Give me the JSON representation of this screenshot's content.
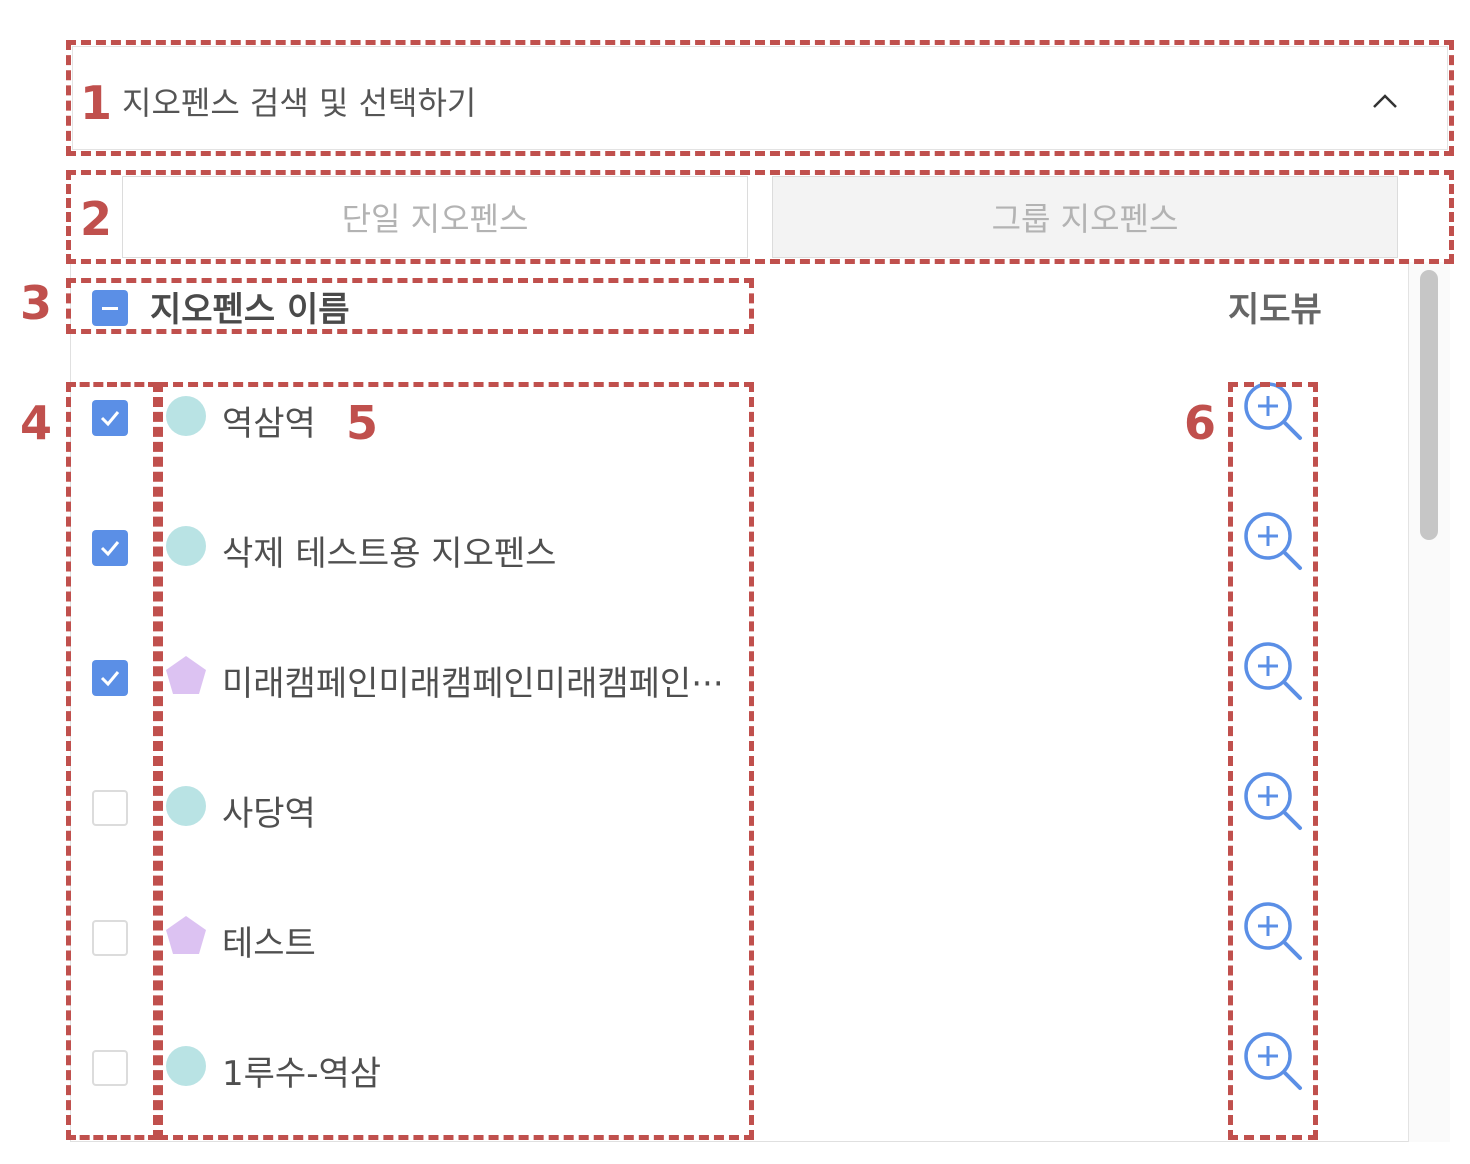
{
  "panel": {
    "title": "지오펜스 검색 및 선택하기"
  },
  "tabs": [
    {
      "label": "단일 지오펜스"
    },
    {
      "label": "그룹 지오펜스"
    }
  ],
  "table": {
    "headers": {
      "name": "지오펜스 이름",
      "map": "지도뷰"
    },
    "rows": [
      {
        "name": "역삼역",
        "checked": true,
        "shape": "circle-icon"
      },
      {
        "name": "삭제 테스트용 지오펜스",
        "checked": true,
        "shape": "circle-icon"
      },
      {
        "name": "미래캠페인미래캠페인미래캠페인···",
        "checked": true,
        "shape": "pentagon-icon"
      },
      {
        "name": "사당역",
        "checked": false,
        "shape": "circle-icon"
      },
      {
        "name": "테스트",
        "checked": false,
        "shape": "pentagon-icon"
      },
      {
        "name": "1루수-역삼",
        "checked": false,
        "shape": "circle-icon"
      }
    ]
  },
  "annotations": [
    "1",
    "2",
    "3",
    "4",
    "5",
    "6"
  ],
  "colors": {
    "annotation": "#c0504d",
    "checkbox": "#5b8fe6",
    "circle_shape": "#b9e3e4",
    "pentagon_shape": "#dcc2f2",
    "zoom_icon": "#5b8fe6"
  }
}
